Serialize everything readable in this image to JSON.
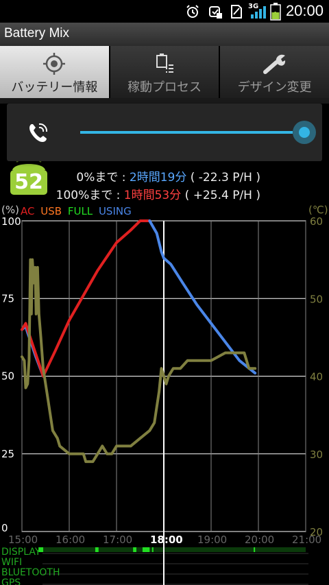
{
  "status_bar": {
    "time": "20:00",
    "battery_level": "52",
    "network_type": "3G",
    "icons": [
      "alarm-icon",
      "sync-icon",
      "sim-icon",
      "signal-icon",
      "battery-icon"
    ]
  },
  "app": {
    "title": "Battery Mix"
  },
  "tabs": [
    {
      "label": "バッテリー情報",
      "icon": "crosshair-icon",
      "active": true
    },
    {
      "label": "稼動プロセス",
      "icon": "clipboard-list-icon",
      "active": false
    },
    {
      "label": "デザイン変更",
      "icon": "wrench-icon",
      "active": false
    }
  ],
  "volume_overlay": {
    "icon": "phone-volume-icon",
    "level": 1.0
  },
  "battery": {
    "level": "52",
    "line0": "0%まで : ",
    "line0_time": "2時間19分",
    "line0_rate": " ( -22.3 P/H )",
    "line100": "100%まで : ",
    "line100_time": "1時間53分",
    "line100_rate": " ( +25.4 P/H )"
  },
  "colors": {
    "ac": "#e02020",
    "usb": "#ff7722",
    "full": "#22dd22",
    "using": "#4a86e8",
    "temperature": "#808040",
    "accent": "#33b5e5"
  },
  "chart_data": {
    "type": "line",
    "left_axis_label": "(%)",
    "right_axis_label": "(℃)",
    "legend": [
      "AC",
      "USB",
      "FULL",
      "USING"
    ],
    "x_ticks": [
      "15:00",
      "16:00",
      "17:00",
      "18:00",
      "19:00",
      "20:00",
      "21:00"
    ],
    "x_current": "18:00",
    "y_ticks": [
      0,
      25,
      50,
      75,
      100
    ],
    "y_range": [
      0,
      100
    ],
    "temp_ticks": [
      20,
      30,
      40,
      50,
      60
    ],
    "temp_range": [
      20,
      60
    ],
    "series": [
      {
        "name": "USING",
        "color": "#4a86e8",
        "points": [
          [
            15.0,
            65
          ],
          [
            15.08,
            66
          ],
          [
            15.12,
            64
          ],
          [
            15.3,
            56
          ],
          [
            15.45,
            50
          ]
        ]
      },
      {
        "name": "AC",
        "color": "#e02020",
        "points": [
          [
            15.0,
            65
          ],
          [
            15.08,
            67
          ],
          [
            15.12,
            65
          ],
          [
            15.45,
            50
          ],
          [
            15.7,
            58
          ],
          [
            16.0,
            68
          ],
          [
            16.3,
            76
          ],
          [
            16.6,
            84
          ],
          [
            17.0,
            93
          ],
          [
            17.3,
            97
          ],
          [
            17.5,
            100
          ],
          [
            17.7,
            100
          ]
        ]
      },
      {
        "name": "USING",
        "color": "#4a86e8",
        "points": [
          [
            17.7,
            100
          ],
          [
            17.85,
            96
          ],
          [
            17.95,
            90
          ],
          [
            18.0,
            88
          ],
          [
            18.15,
            86
          ],
          [
            18.4,
            80
          ],
          [
            18.7,
            73
          ],
          [
            19.0,
            67
          ],
          [
            19.3,
            61
          ],
          [
            19.6,
            55
          ],
          [
            19.93,
            51
          ]
        ]
      },
      {
        "name": "temperature",
        "color": "#808040",
        "axis": "right",
        "points": [
          [
            15.0,
            42.5
          ],
          [
            15.05,
            42
          ],
          [
            15.08,
            38.5
          ],
          [
            15.12,
            39
          ],
          [
            15.15,
            42
          ],
          [
            15.18,
            55
          ],
          [
            15.2,
            48
          ],
          [
            15.22,
            55
          ],
          [
            15.25,
            52
          ],
          [
            15.28,
            54
          ],
          [
            15.3,
            48
          ],
          [
            15.33,
            54
          ],
          [
            15.36,
            48
          ],
          [
            15.4,
            45
          ],
          [
            15.45,
            41
          ],
          [
            15.55,
            37
          ],
          [
            15.65,
            33
          ],
          [
            15.75,
            32
          ],
          [
            15.8,
            31
          ],
          [
            15.9,
            30.5
          ],
          [
            16.0,
            30
          ],
          [
            16.1,
            30
          ],
          [
            16.2,
            30
          ],
          [
            16.3,
            30
          ],
          [
            16.35,
            29
          ],
          [
            16.5,
            29
          ],
          [
            16.6,
            30
          ],
          [
            16.7,
            31
          ],
          [
            16.8,
            30
          ],
          [
            16.9,
            30
          ],
          [
            17.0,
            31
          ],
          [
            17.1,
            31
          ],
          [
            17.2,
            31
          ],
          [
            17.3,
            31
          ],
          [
            17.5,
            32
          ],
          [
            17.7,
            33
          ],
          [
            17.8,
            34
          ],
          [
            17.9,
            38
          ],
          [
            17.95,
            41
          ],
          [
            18.0,
            40
          ],
          [
            18.05,
            39
          ],
          [
            18.1,
            40
          ],
          [
            18.2,
            41
          ],
          [
            18.35,
            41
          ],
          [
            18.5,
            42
          ],
          [
            18.8,
            42
          ],
          [
            19.0,
            42
          ],
          [
            19.3,
            43
          ],
          [
            19.6,
            43
          ],
          [
            19.7,
            43
          ],
          [
            19.75,
            42
          ],
          [
            19.8,
            41
          ],
          [
            19.93,
            41
          ]
        ]
      }
    ],
    "timeline_rows": [
      "DISPLAY",
      "WIFI",
      "BLUETOOTH",
      "GPS"
    ],
    "display_on_segments": [
      [
        15.35,
        15.45
      ],
      [
        16.55,
        16.62
      ],
      [
        17.35,
        17.42
      ],
      [
        17.55,
        17.7
      ],
      [
        17.75,
        17.78
      ],
      [
        19.9,
        19.93
      ]
    ]
  }
}
